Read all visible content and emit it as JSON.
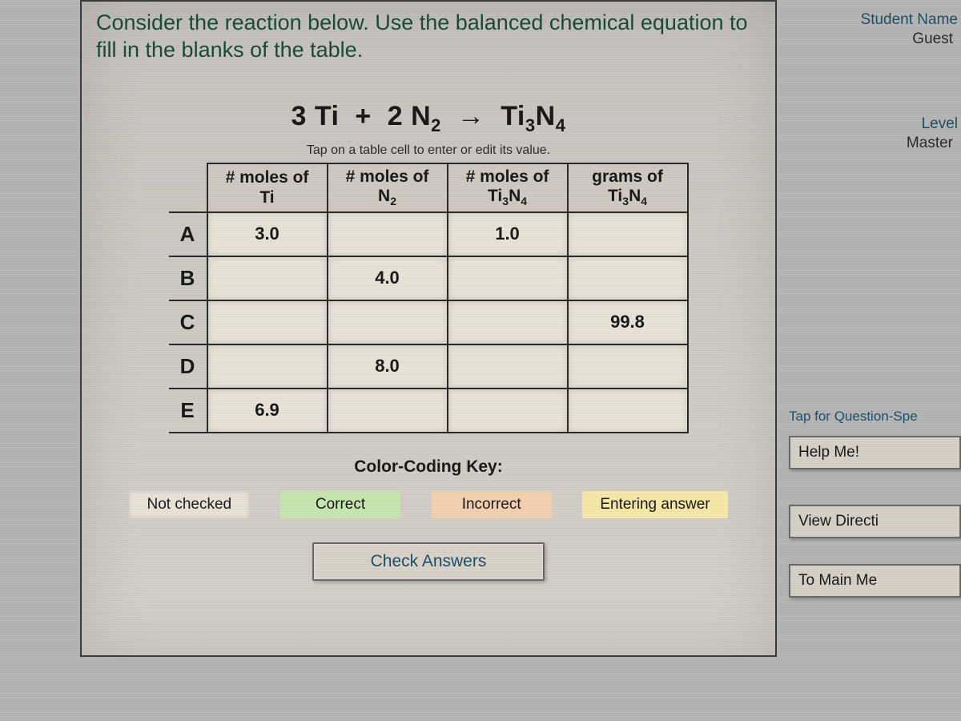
{
  "prompt": "Consider the reaction below. Use the balanced chemical equation to fill in the blanks of the table.",
  "equation": {
    "lhs_coef1": "3",
    "lhs_sp1": "Ti",
    "plus": "+",
    "lhs_coef2": "2",
    "lhs_sp2_base": "N",
    "lhs_sp2_sub": "2",
    "arrow": "→",
    "rhs_base1": "Ti",
    "rhs_sub1": "3",
    "rhs_base2": "N",
    "rhs_sub2": "4"
  },
  "tap_hint": "Tap on a table cell to enter or edit its value.",
  "columns": {
    "c1_line1": "# moles of",
    "c1_line2": "Ti",
    "c2_line1": "# moles of",
    "c2_line2_base": "N",
    "c2_line2_sub": "2",
    "c3_line1": "# moles of",
    "c3_line2_b1": "Ti",
    "c3_line2_s1": "3",
    "c3_line2_b2": "N",
    "c3_line2_s2": "4",
    "c4_line1": "grams of",
    "c4_line2_b1": "Ti",
    "c4_line2_s1": "3",
    "c4_line2_b2": "N",
    "c4_line2_s2": "4"
  },
  "rows": [
    {
      "label": "A",
      "cells": [
        "3.0",
        "",
        "1.0",
        ""
      ]
    },
    {
      "label": "B",
      "cells": [
        "",
        "4.0",
        "",
        ""
      ]
    },
    {
      "label": "C",
      "cells": [
        "",
        "",
        "",
        "99.8"
      ]
    },
    {
      "label": "D",
      "cells": [
        "",
        "8.0",
        "",
        ""
      ]
    },
    {
      "label": "E",
      "cells": [
        "6.9",
        "",
        "",
        ""
      ]
    }
  ],
  "key": {
    "title": "Color-Coding Key:",
    "notchecked": "Not checked",
    "correct": "Correct",
    "incorrect": "Incorrect",
    "entering": "Entering answer"
  },
  "check_button": "Check Answers",
  "sidebar": {
    "student_name_label": "Student Name",
    "student_name_value": "Guest",
    "level_label": "Level",
    "level_value": "Master",
    "question_hint": "Tap for Question-Spe",
    "help_button": "Help Me!",
    "view_directions": "View Directi",
    "main_menu": "To Main Me"
  }
}
